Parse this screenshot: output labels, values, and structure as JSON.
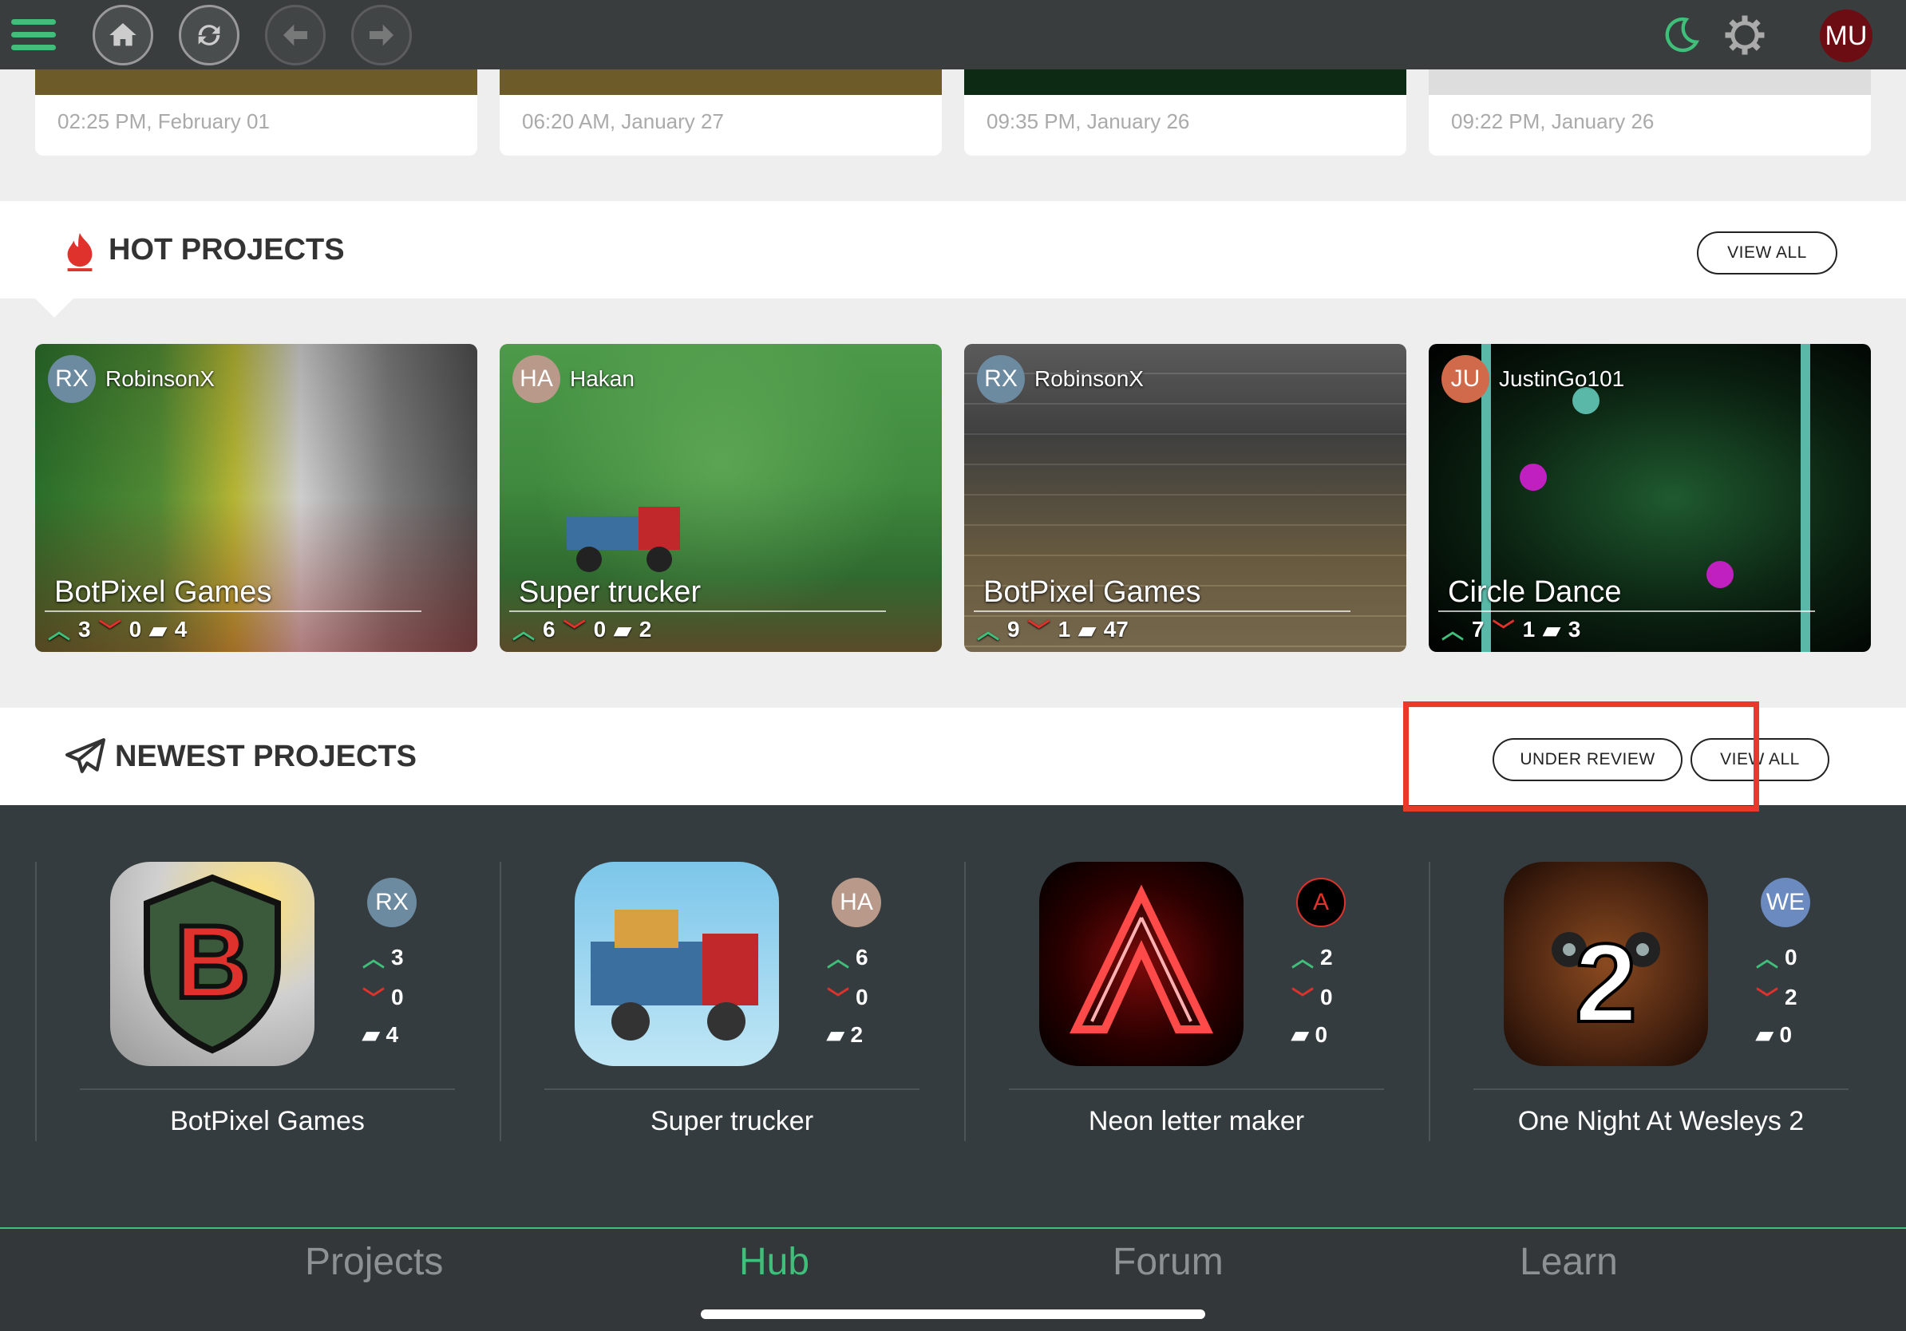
{
  "topbar": {
    "user_initials": "MU"
  },
  "recent": [
    {
      "time": "02:25 PM, February 01"
    },
    {
      "time": "06:20 AM, January 27"
    },
    {
      "time": "09:35 PM, January 26"
    },
    {
      "time": "09:22 PM, January 26"
    }
  ],
  "hot": {
    "title": "HOT PROJECTS",
    "view_all": "VIEW ALL",
    "cards": [
      {
        "user_initials": "RX",
        "user": "RobinsonX",
        "title": "BotPixel Games",
        "up": "3",
        "down": "0",
        "comments": "4"
      },
      {
        "user_initials": "HA",
        "user": "Hakan",
        "title": "Super trucker",
        "up": "6",
        "down": "0",
        "comments": "2"
      },
      {
        "user_initials": "RX",
        "user": "RobinsonX",
        "title": "BotPixel Games",
        "up": "9",
        "down": "1",
        "comments": "47"
      },
      {
        "user_initials": "JU",
        "user": "JustinGo101",
        "title": "Circle Dance",
        "up": "7",
        "down": "1",
        "comments": "3"
      }
    ]
  },
  "newest": {
    "title": "NEWEST PROJECTS",
    "under_review": "UNDER REVIEW",
    "view_all": "VIEW ALL",
    "projects": [
      {
        "name": "BotPixel Games",
        "avatar": "RX",
        "up": "3",
        "down": "0",
        "comments": "4"
      },
      {
        "name": "Super trucker",
        "avatar": "HA",
        "up": "6",
        "down": "0",
        "comments": "2"
      },
      {
        "name": "Neon letter maker",
        "avatar": "A",
        "up": "2",
        "down": "0",
        "comments": "0"
      },
      {
        "name": "One Night At Wesleys 2",
        "avatar": "WE",
        "up": "0",
        "down": "2",
        "comments": "0"
      }
    ]
  },
  "tabs": [
    {
      "label": "Projects",
      "active": false
    },
    {
      "label": "Hub",
      "active": true
    },
    {
      "label": "Forum",
      "active": false
    },
    {
      "label": "Learn",
      "active": false
    }
  ],
  "colors": {
    "accent": "#3fbf7a",
    "down": "#e0322c",
    "annotation": "#e8392a"
  }
}
